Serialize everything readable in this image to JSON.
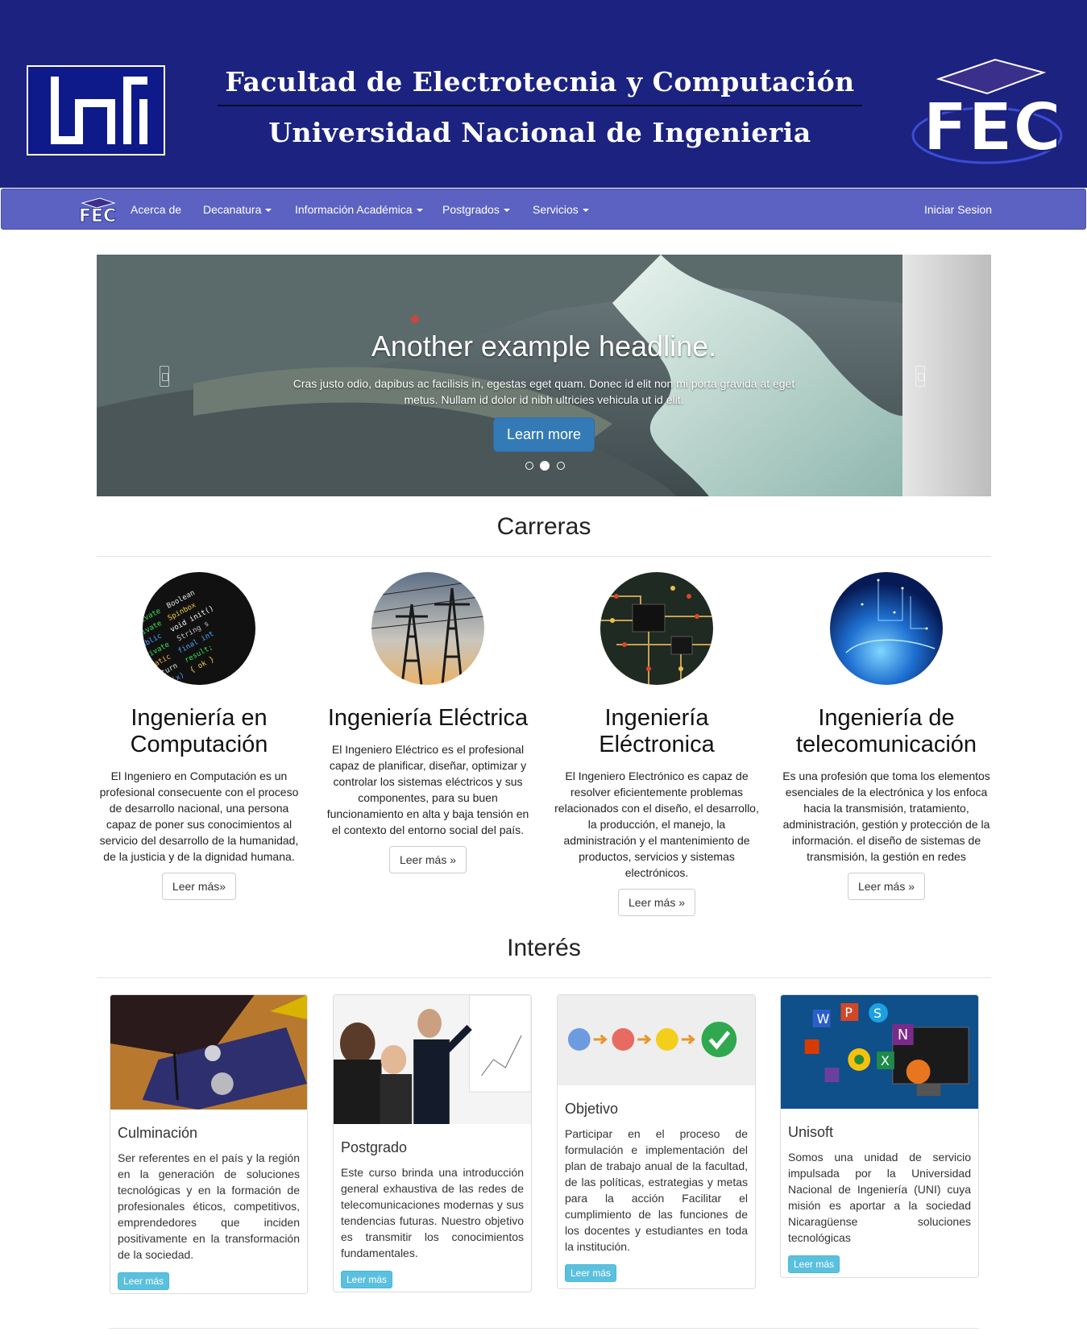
{
  "header": {
    "title_line1": "Facultad de Electrotecnia y Computación",
    "title_line2": "Universidad Nacional de Ingenieria",
    "logo_left": "uni-logo",
    "logo_right": "fec-logo",
    "bg_color": "#1c2280"
  },
  "navbar": {
    "brand_icon": "fec-logo",
    "items": [
      {
        "label": "Acerca de",
        "dropdown": false
      },
      {
        "label": "Decanatura",
        "dropdown": true
      },
      {
        "label": "Información Académica",
        "dropdown": true
      },
      {
        "label": "Postgrados",
        "dropdown": true
      },
      {
        "label": "Servicios",
        "dropdown": true
      }
    ],
    "login_label": "Iniciar Sesion",
    "bg_color": "#5b62c2"
  },
  "carousel": {
    "headline": "Another example headline.",
    "text": "Cras justo odio, dapibus ac facilisis in, egestas eget quam. Donec id elit non mi porta gravida at eget metus. Nullam id dolor id nibh ultricies vehicula ut id elit.",
    "button_label": "Learn more",
    "prev_icon": "chevron-left-icon",
    "next_icon": "chevron-right-icon",
    "slide_count": 3,
    "active_slide": 2
  },
  "carreras": {
    "title": "Carreras",
    "read_more_first": "Leer más»",
    "read_more": "Leer más »",
    "items": [
      {
        "title": "Ingeniería en Computación",
        "text": "El Ingeniero en Computación es un profesional consecuente con el proceso de desarrollo nacional, una persona capaz de poner sus conocimientos al servicio del desarrollo de la humanidad, de la justicia y de la dignidad humana.",
        "image": "code-screen-image"
      },
      {
        "title": "Ingeniería Eléctrica",
        "text": "El Ingeniero Eléctrico es el profesional capaz de planificar, diseñar, optimizar y controlar los sistemas eléctricos y sus componentes, para su buen funcionamiento en alta y baja tensión en el contexto del entorno social del país.",
        "image": "power-towers-image"
      },
      {
        "title": "Ingeniería Eléctronica",
        "text": "El Ingeniero Electrónico es capaz de resolver eficientemente problemas relacionados con el diseño, el desarrollo, la producción, el manejo, la administración y el mantenimiento de productos, servicios y sistemas electrónicos.",
        "image": "circuit-board-image"
      },
      {
        "title": "Ingeniería de telecomunicación",
        "text": "Es una profesión que toma los elementos esenciales de la electrónica y los enfoca hacia la transmisión, tratamiento, administración, gestión y protección de la información. el diseño de sistemas de transmisión, la gestión en redes",
        "image": "network-globe-image"
      }
    ]
  },
  "interes": {
    "title": "Interés",
    "button_label": "Leer más",
    "items": [
      {
        "title": "Culminación",
        "text": "Ser referentes en el país y la región en la generación de soluciones tecnológicas y en la formación de profesionales éticos, competitivos, emprendedores que inciden positivamente en la transformación de la sociedad.",
        "image": "graduation-cap-image"
      },
      {
        "title": "Postgrado",
        "text": "Este curso brinda una introducción general exhaustiva de las redes de telecomunicaciones modernas y sus tendencias futuras. Nuestro objetivo es transmitir los conocimientos fundamentales.",
        "image": "business-presentation-image"
      },
      {
        "title": "Objetivo",
        "text": "Participar en el proceso de formulación e implementación del plan de trabajo anual de la facultad, de las políticas, estrategias y metas para la acción Facilitar el cumplimiento de las funciones de los docentes y estudiantes en toda la institución.",
        "image": "process-steps-image"
      },
      {
        "title": "Unisoft",
        "text": "Somos una unidad de servicio impulsada por la Universidad Nacional de Ingeniería (UNI) cuya misión es aportar a la sociedad Nicaragüense soluciones tecnológicas",
        "image": "software-icons-image"
      }
    ]
  }
}
